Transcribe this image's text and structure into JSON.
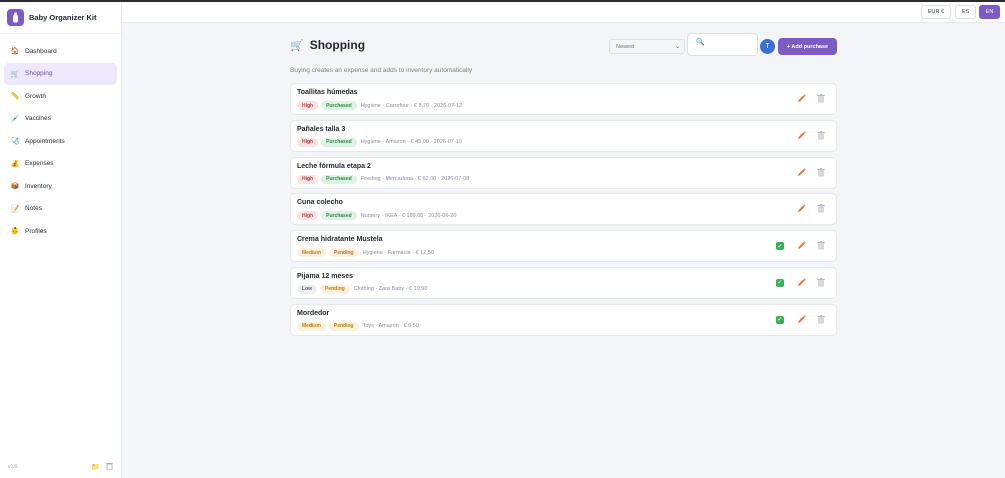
{
  "app": {
    "name": "Baby Organizer Kit",
    "version": "v1.0"
  },
  "sidebar": {
    "items": [
      {
        "label": "Dashboard",
        "icon": "house-icon",
        "glyph": "🏠",
        "active": false
      },
      {
        "label": "Shopping",
        "icon": "cart-icon",
        "glyph": "🛒",
        "active": true
      },
      {
        "label": "Growth",
        "icon": "ruler-icon",
        "glyph": "📏",
        "active": false
      },
      {
        "label": "Vaccines",
        "icon": "syringe-icon",
        "glyph": "💉",
        "active": false
      },
      {
        "label": "Appointments",
        "icon": "stethoscope-icon",
        "glyph": "🩺",
        "active": false
      },
      {
        "label": "Expenses",
        "icon": "money-bag-icon",
        "glyph": "💰",
        "active": false
      },
      {
        "label": "Inventory",
        "icon": "box-icon",
        "glyph": "📦",
        "active": false
      },
      {
        "label": "Notes",
        "icon": "notepad-icon",
        "glyph": "📝",
        "active": false
      },
      {
        "label": "Profiles",
        "icon": "baby-icon",
        "glyph": "👶",
        "active": false
      }
    ]
  },
  "topbar": {
    "currency": "EUR €",
    "lang_es": "ES",
    "lang_en": "EN",
    "active_lang": "EN"
  },
  "page": {
    "title": "Shopping",
    "subtitle": "Buying creates an expense and adds to inventory automatically",
    "sort_value": "Newest",
    "search_value": "",
    "filter_label": "T",
    "add_button": "+ Add purchase"
  },
  "purchases": [
    {
      "name": "Toallitas húmedas",
      "priority": "High",
      "status": "Purchased",
      "meta": "Hygiene · Carrefour · € 8,70 · 2026-07-12"
    },
    {
      "name": "Pañales talla 3",
      "priority": "High",
      "status": "Purchased",
      "meta": "Hygiene · Amazon · € 45,00 · 2026-07-10"
    },
    {
      "name": "Leche fórmula etapa 2",
      "priority": "High",
      "status": "Purchased",
      "meta": "Feeding · Mercadona · € 62,00 · 2026-07-08"
    },
    {
      "name": "Cuna colecho",
      "priority": "High",
      "status": "Purchased",
      "meta": "Nursery · IKEA · € 189,00 · 2026-06-20"
    },
    {
      "name": "Crema hidratante Mustela",
      "priority": "Medium",
      "status": "Pending",
      "meta": "Hygiene · Farmacia · € 12,50"
    },
    {
      "name": "Pijama 12 meses",
      "priority": "Low",
      "status": "Pending",
      "meta": "Clothing · Zara Baby · € 19,90"
    },
    {
      "name": "Mordedor",
      "priority": "Medium",
      "status": "Pending",
      "meta": "Toys · Amazon · € 6,50"
    }
  ],
  "colors": {
    "accent": "#7c5cc4",
    "edit": "#e8733a",
    "check": "#3fae5a",
    "filter": "#3a6fd8"
  }
}
